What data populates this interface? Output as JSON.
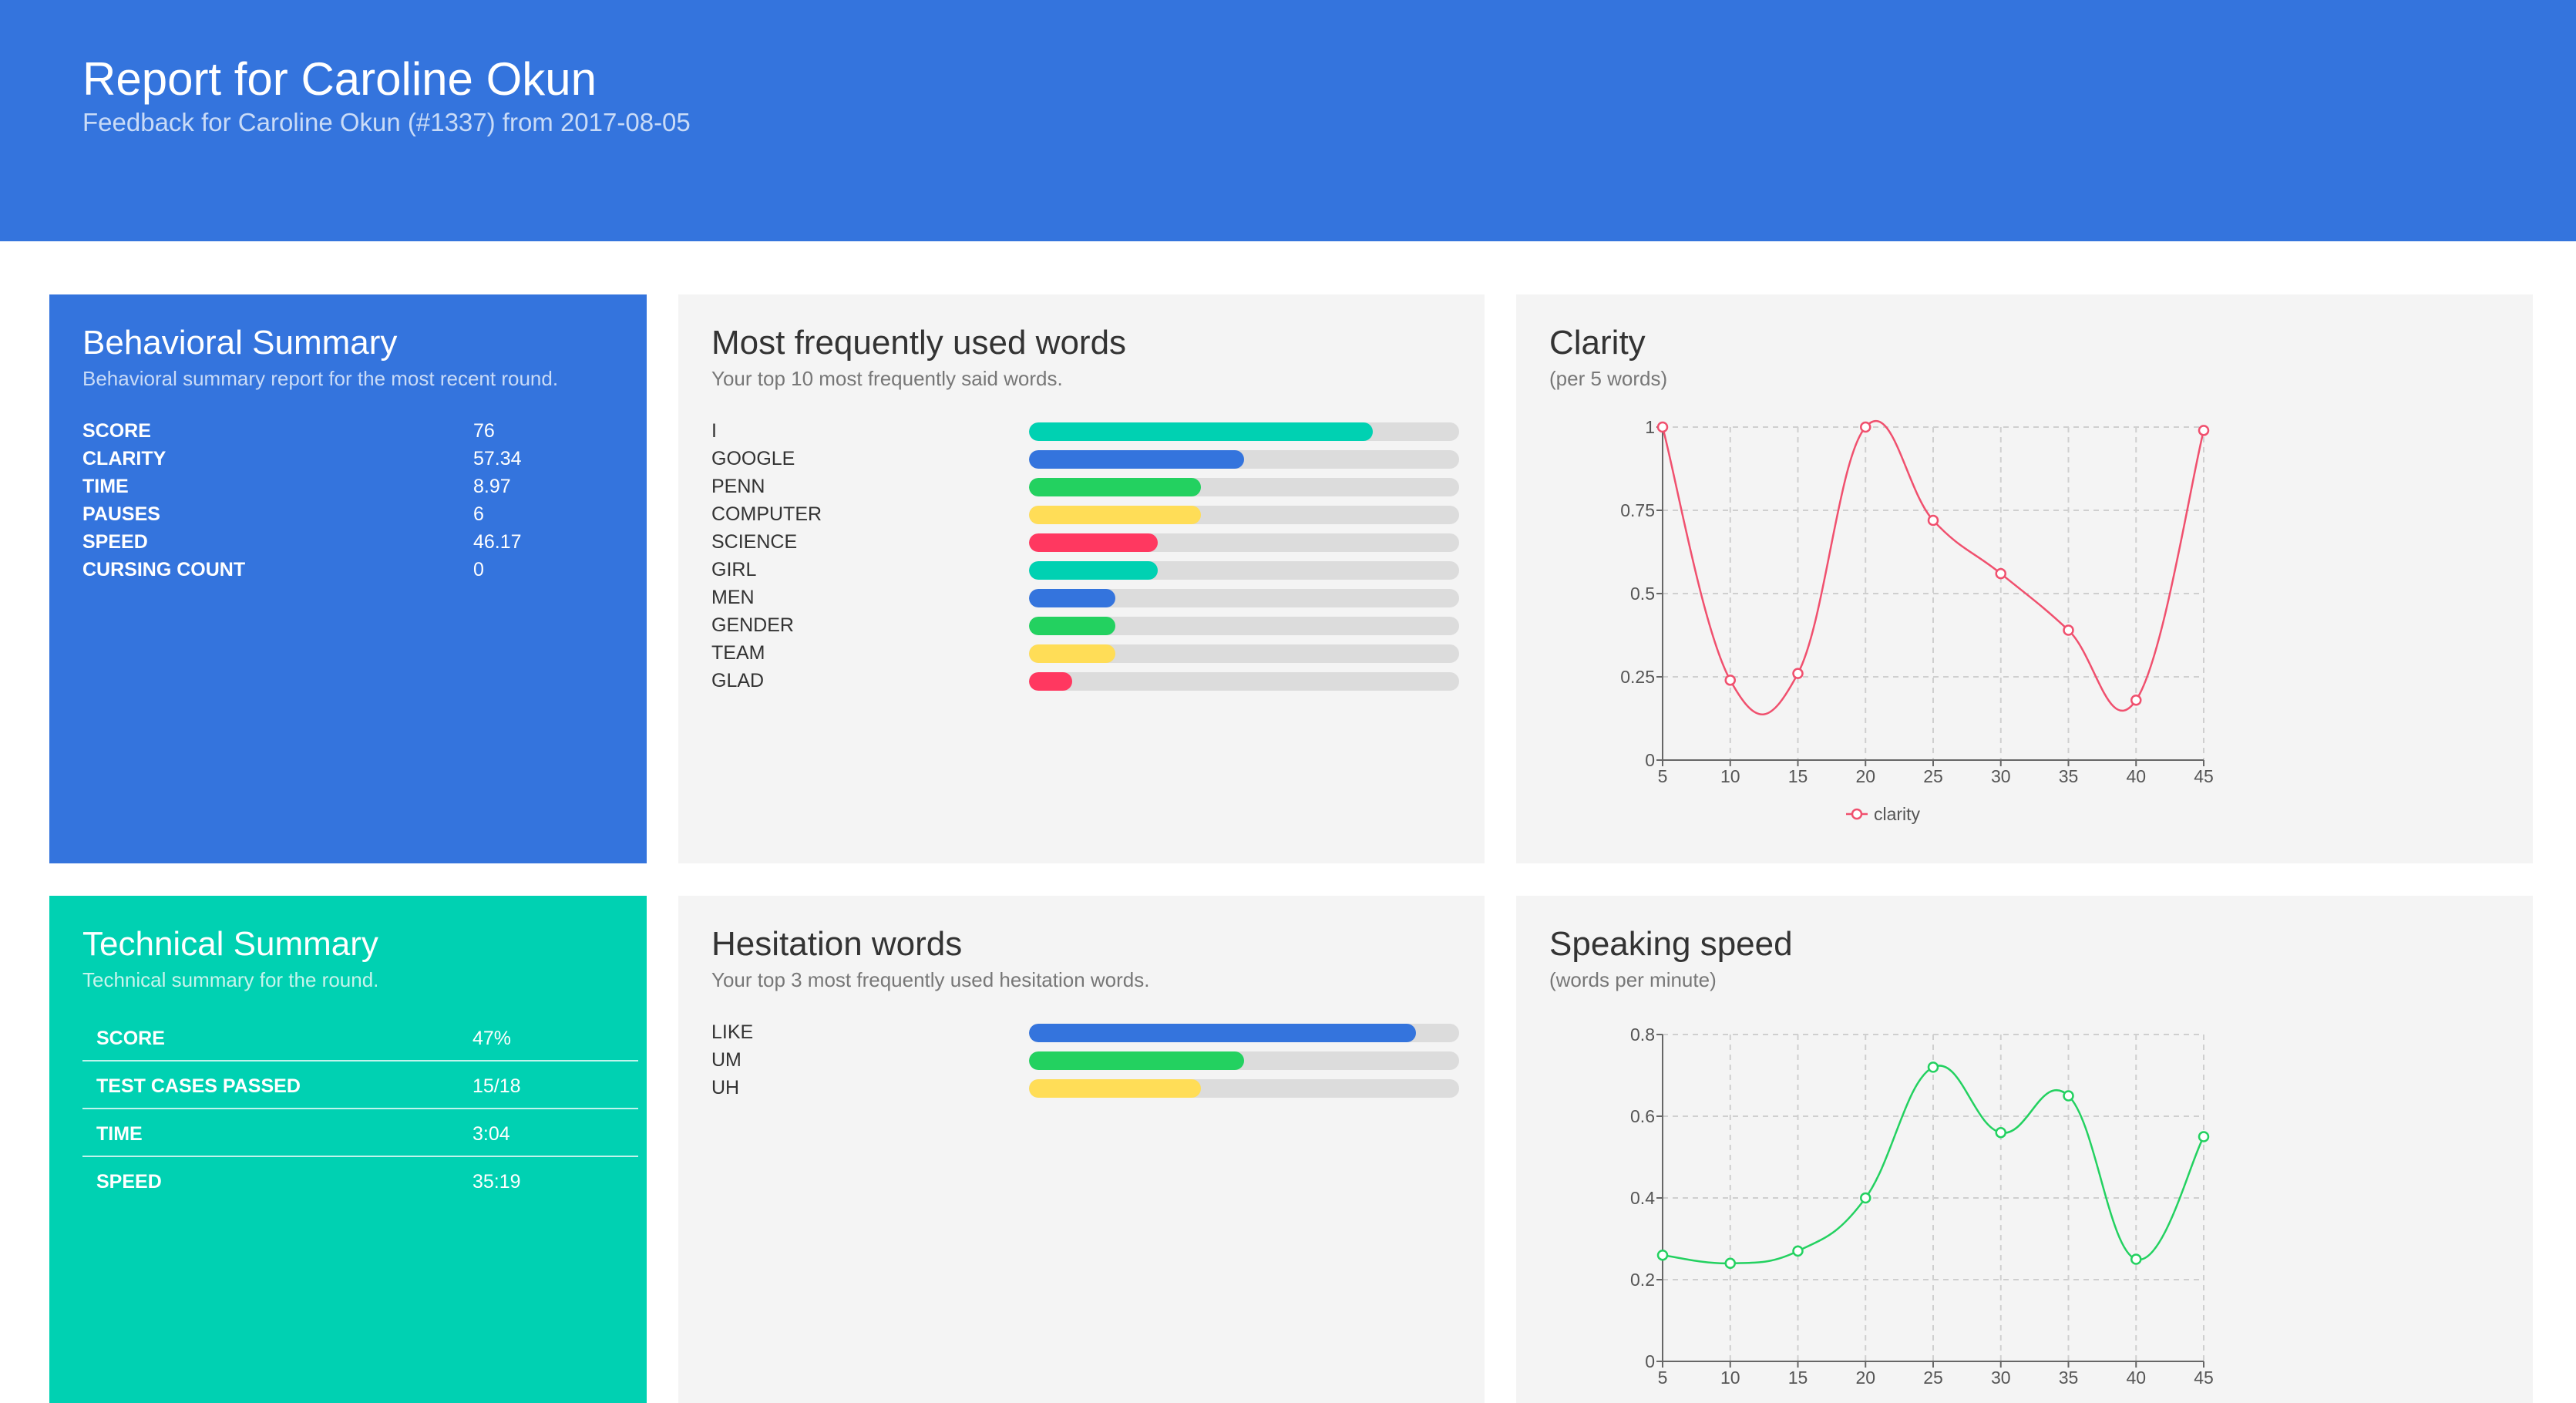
{
  "header": {
    "title_prefix": "Report for ",
    "title_name": "Caroline Okun",
    "subtitle": "Feedback for Caroline Okun (#1337) from 2017-08-05"
  },
  "behavioral": {
    "title": "Behavioral Summary",
    "subtitle": "Behavioral summary report for the most recent round.",
    "rows": [
      {
        "label": "SCORE",
        "value": "76"
      },
      {
        "label": "CLARITY",
        "value": "57.34"
      },
      {
        "label": "TIME",
        "value": "8.97"
      },
      {
        "label": "PAUSES",
        "value": "6"
      },
      {
        "label": "SPEED",
        "value": "46.17"
      },
      {
        "label": "CURSING COUNT",
        "value": "0"
      }
    ]
  },
  "technical": {
    "title": "Technical Summary",
    "subtitle": "Technical summary for the round.",
    "rows": [
      {
        "label": "SCORE",
        "value": "47%"
      },
      {
        "label": "TEST CASES PASSED",
        "value": "15/18"
      },
      {
        "label": "TIME",
        "value": "3:04"
      },
      {
        "label": "SPEED",
        "value": "35:19"
      }
    ]
  },
  "frequent_words": {
    "title": "Most frequently used words",
    "subtitle": "Your top 10 most frequently said words.",
    "items": [
      {
        "word": "I",
        "level": 0.8,
        "color": "#00d1b2"
      },
      {
        "word": "GOOGLE",
        "level": 0.5,
        "color": "#3474dd"
      },
      {
        "word": "PENN",
        "level": 0.4,
        "color": "#23d160"
      },
      {
        "word": "COMPUTER",
        "level": 0.4,
        "color": "#ffdd57"
      },
      {
        "word": "SCIENCE",
        "level": 0.3,
        "color": "#ff3860"
      },
      {
        "word": "GIRL",
        "level": 0.3,
        "color": "#00d1b2"
      },
      {
        "word": "MEN",
        "level": 0.2,
        "color": "#3474dd"
      },
      {
        "word": "GENDER",
        "level": 0.2,
        "color": "#23d160"
      },
      {
        "word": "TEAM",
        "level": 0.2,
        "color": "#ffdd57"
      },
      {
        "word": "GLAD",
        "level": 0.1,
        "color": "#ff3860"
      }
    ]
  },
  "hesitation_words": {
    "title": "Hesitation words",
    "subtitle": "Your top 3 most frequently used hesitation words.",
    "items": [
      {
        "word": "LIKE",
        "level": 0.9,
        "color": "#3474dd"
      },
      {
        "word": "UM",
        "level": 0.5,
        "color": "#23d160"
      },
      {
        "word": "UH",
        "level": 0.4,
        "color": "#ffdd57"
      }
    ]
  },
  "clarity": {
    "title": "Clarity",
    "subtitle": "(per 5 words)"
  },
  "speaking_speed": {
    "title": "Speaking speed",
    "subtitle": "(words per minute)"
  },
  "chart_data": [
    {
      "type": "line",
      "x": [
        5,
        10,
        15,
        20,
        25,
        30,
        35,
        40,
        45
      ],
      "series": [
        {
          "name": "clarity",
          "color": "#f0506e",
          "values": [
            1.0,
            0.24,
            0.26,
            1.0,
            0.72,
            0.56,
            0.39,
            0.18,
            0.99
          ]
        }
      ],
      "xlim": [
        5,
        45
      ],
      "ylim": [
        0,
        1
      ],
      "xticks": [
        "5",
        "10",
        "15",
        "20",
        "25",
        "30",
        "35",
        "40",
        "45"
      ],
      "yticks": [
        "0",
        "0.25",
        "0.5",
        "0.75",
        "1"
      ],
      "ytick_values": [
        0,
        0.25,
        0.5,
        0.75,
        1
      ],
      "grid": true,
      "legend": "bottom-center",
      "title": "",
      "xlabel": "",
      "ylabel": ""
    },
    {
      "type": "line",
      "x": [
        5,
        10,
        15,
        20,
        25,
        30,
        35,
        40,
        45
      ],
      "series": [
        {
          "color": "#23d160",
          "values": [
            0.26,
            0.24,
            0.27,
            0.4,
            0.72,
            0.56,
            0.65,
            0.25,
            0.55
          ]
        }
      ],
      "xlim": [
        5,
        45
      ],
      "ylim": [
        0,
        0.8
      ],
      "xticks": [
        "5",
        "10",
        "15",
        "20",
        "25",
        "30",
        "35",
        "40",
        "45"
      ],
      "yticks": [
        "0",
        "0.2",
        "0.4",
        "0.6",
        "0.8"
      ],
      "ytick_values": [
        0,
        0.2,
        0.4,
        0.6,
        0.8
      ],
      "grid": true,
      "title": "",
      "xlabel": "",
      "ylabel": ""
    }
  ]
}
